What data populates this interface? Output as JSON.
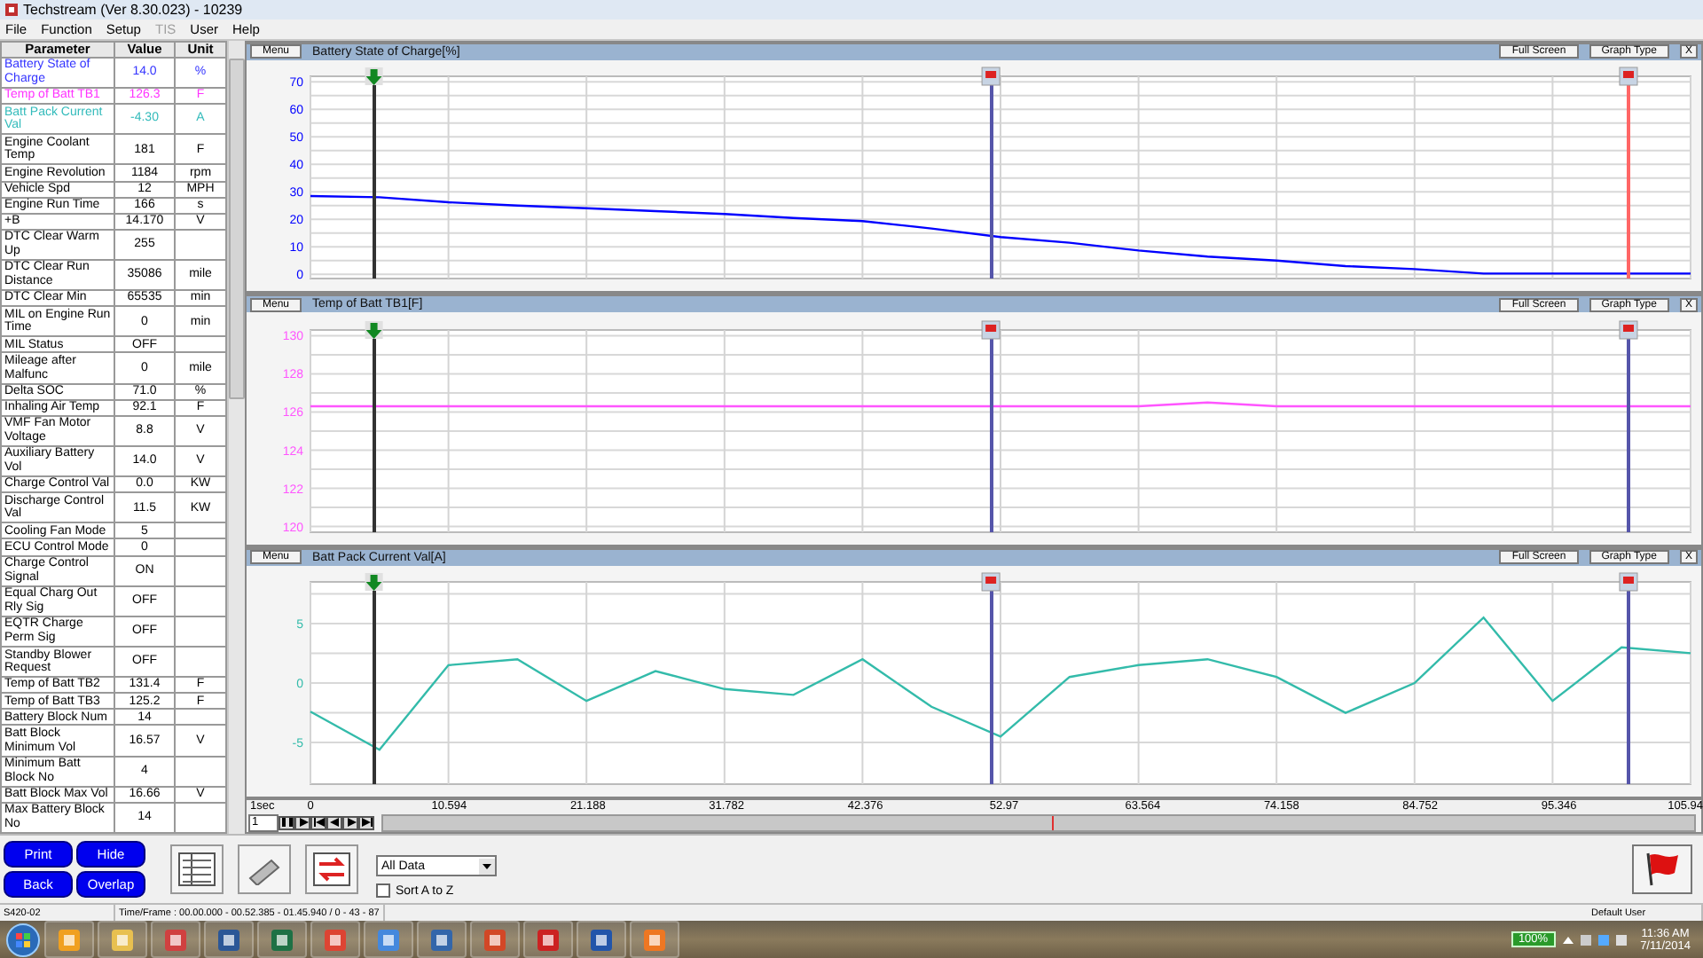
{
  "window": {
    "title": "Techstream (Ver 8.30.023) - 10239"
  },
  "menu": [
    {
      "label": "File",
      "disabled": false
    },
    {
      "label": "Function",
      "disabled": false
    },
    {
      "label": "Setup",
      "disabled": false
    },
    {
      "label": "TIS",
      "disabled": true
    },
    {
      "label": "User",
      "disabled": false
    },
    {
      "label": "Help",
      "disabled": false
    }
  ],
  "table": {
    "columns": [
      "Parameter",
      "Value",
      "Unit"
    ],
    "rows": [
      {
        "parameter": "Battery State of Charge",
        "value": "14.0",
        "unit": "%",
        "color": "#3333ff"
      },
      {
        "parameter": "Temp of Batt TB1",
        "value": "126.3",
        "unit": "F",
        "color": "#ff33ff"
      },
      {
        "parameter": "Batt Pack Current Val",
        "value": "-4.30",
        "unit": "A",
        "color": "#33bbbb"
      },
      {
        "parameter": "Engine Coolant Temp",
        "value": "181",
        "unit": "F",
        "color": "#000000"
      },
      {
        "parameter": "Engine Revolution",
        "value": "1184",
        "unit": "rpm",
        "color": "#000000"
      },
      {
        "parameter": "Vehicle Spd",
        "value": "12",
        "unit": "MPH",
        "color": "#000000"
      },
      {
        "parameter": "Engine Run Time",
        "value": "166",
        "unit": "s",
        "color": "#000000"
      },
      {
        "parameter": "+B",
        "value": "14.170",
        "unit": "V",
        "color": "#000000"
      },
      {
        "parameter": "DTC Clear Warm Up",
        "value": "255",
        "color": "#000000"
      },
      {
        "parameter": "DTC Clear Run Distance",
        "value": "35086",
        "unit": "mile",
        "color": "#000000"
      },
      {
        "parameter": "DTC Clear Min",
        "value": "65535",
        "unit": "min",
        "color": "#000000"
      },
      {
        "parameter": "MIL on Engine Run Time",
        "value": "0",
        "unit": "min",
        "color": "#000000"
      },
      {
        "parameter": "MIL Status",
        "value": "OFF",
        "color": "#000000"
      },
      {
        "parameter": "Mileage after Malfunc",
        "value": "0",
        "unit": "mile",
        "color": "#000000"
      },
      {
        "parameter": "Delta SOC",
        "value": "71.0",
        "unit": "%",
        "color": "#000000"
      },
      {
        "parameter": "Inhaling Air Temp",
        "value": "92.1",
        "unit": "F",
        "color": "#000000"
      },
      {
        "parameter": "VMF Fan Motor Voltage",
        "value": "8.8",
        "unit": "V",
        "color": "#000000"
      },
      {
        "parameter": "Auxiliary Battery Vol",
        "value": "14.0",
        "unit": "V",
        "color": "#000000"
      },
      {
        "parameter": "Charge Control Val",
        "value": "0.0",
        "unit": "KW",
        "color": "#000000"
      },
      {
        "parameter": "Discharge Control Val",
        "value": "11.5",
        "unit": "KW",
        "color": "#000000"
      },
      {
        "parameter": "Cooling Fan Mode",
        "value": "5",
        "color": "#000000"
      },
      {
        "parameter": "ECU Control Mode",
        "value": "0",
        "color": "#000000"
      },
      {
        "parameter": "Charge Control Signal",
        "value": "ON",
        "color": "#000000"
      },
      {
        "parameter": "Equal Charg Out Rly Sig",
        "value": "OFF",
        "color": "#000000"
      },
      {
        "parameter": "EQTR Charge Perm Sig",
        "value": "OFF",
        "color": "#000000"
      },
      {
        "parameter": "Standby Blower Request",
        "value": "OFF",
        "color": "#000000"
      },
      {
        "parameter": "Temp of Batt TB2",
        "value": "131.4",
        "unit": "F",
        "color": "#000000"
      },
      {
        "parameter": "Temp of Batt TB3",
        "value": "125.2",
        "unit": "F",
        "color": "#000000"
      },
      {
        "parameter": "Battery Block Num",
        "value": "14",
        "color": "#000000"
      },
      {
        "parameter": "Batt Block Minimum Vol",
        "value": "16.57",
        "unit": "V",
        "color": "#000000"
      },
      {
        "parameter": "Minimum Batt Block No",
        "value": "4",
        "color": "#000000"
      },
      {
        "parameter": "Batt Block Max Vol",
        "value": "16.66",
        "unit": "V",
        "color": "#000000"
      },
      {
        "parameter": "Max Battery Block No",
        "value": "14",
        "color": "#000000"
      }
    ]
  },
  "buttons": [
    "Print",
    "Hide",
    "Back",
    "Overlap"
  ],
  "graphs": [
    {
      "menu": "Menu",
      "title": "Battery State of Charge[%]",
      "full_screen": "Full Screen",
      "graph_type": "Graph Type",
      "close": "X",
      "cursors": [
        {
          "kind": "start",
          "level": 0.046,
          "color": "#333333"
        },
        {
          "kind": "flag",
          "level": 0.493,
          "color": "#5555aa"
        },
        {
          "kind": "flag",
          "level": 0.955,
          "color": "#ff6666"
        }
      ],
      "chart_data": {
        "type": "line",
        "categories": [
          null,
          null,
          null,
          null,
          null,
          null,
          null,
          null,
          null,
          null,
          null,
          null,
          null,
          null,
          null,
          null,
          null,
          null,
          null,
          null,
          null
        ],
        "series": [
          {
            "color": "#0000ff",
            "values": [
              28.5,
              28,
              26.2,
              25,
              24,
              23,
              22,
              20.5,
              19.4,
              16.7,
              13.6,
              11.5,
              8.7,
              6.5,
              5,
              3,
              1.9,
              0.3,
              0.3,
              0.3,
              0.3
            ]
          }
        ],
        "grid": true,
        "ylim": [
          -1.5,
          72
        ],
        "yticks": [
          0,
          10,
          20,
          30,
          40,
          50,
          60,
          70
        ]
      }
    },
    {
      "menu": "Menu",
      "title": "Temp of Batt TB1[F]",
      "full_screen": "Full Screen",
      "graph_type": "Graph Type",
      "close": "X",
      "cursors": [
        {
          "kind": "start",
          "level": 0.046,
          "color": "#333333"
        },
        {
          "kind": "flag",
          "level": 0.493,
          "color": "#5555aa"
        },
        {
          "kind": "flag",
          "level": 0.955,
          "color": "#5555aa"
        }
      ],
      "chart_data": {
        "type": "line",
        "categories": [
          null,
          null,
          null,
          null,
          null,
          null,
          null,
          null,
          null,
          null,
          null,
          null,
          null,
          null,
          null,
          null,
          null,
          null,
          null,
          null,
          null
        ],
        "series": [
          {
            "color": "#ff55ff",
            "values": [
              126.3,
              126.3,
              126.3,
              126.3,
              126.3,
              126.3,
              126.3,
              126.3,
              126.3,
              126.3,
              126.3,
              126.3,
              126.3,
              126.5,
              126.3,
              126.3,
              126.3,
              126.3,
              126.3,
              126.3,
              126.3
            ]
          }
        ],
        "grid": true,
        "ylim": [
          119.7,
          130.3
        ],
        "yticks": [
          120,
          122,
          124,
          126,
          128,
          130
        ]
      }
    },
    {
      "menu": "Menu",
      "title": "Batt Pack Current Val[A]",
      "full_screen": "Full Screen",
      "graph_type": "Graph Type",
      "close": "X",
      "cursors": [
        {
          "kind": "start",
          "level": 0.046,
          "color": "#333333"
        },
        {
          "kind": "flag",
          "level": 0.493,
          "color": "#5555aa"
        },
        {
          "kind": "flag",
          "level": 0.955,
          "color": "#5555aa"
        }
      ],
      "chart_data": {
        "type": "line",
        "categories": [
          null,
          null,
          null,
          null,
          null,
          null,
          null,
          null,
          null,
          null,
          null,
          null,
          null,
          null,
          null,
          null,
          null,
          null,
          null,
          null,
          null
        ],
        "series": [
          {
            "color": "#33bbaa",
            "values": [
              -2.4,
              -5.6,
              1.5,
              2.0,
              -1.5,
              1.0,
              -0.5,
              -1.0,
              2.0,
              -2.0,
              -4.5,
              0.5,
              1.5,
              2.0,
              0.5,
              -2.5,
              0.0,
              5.5,
              -1.5,
              3.0,
              2.5
            ]
          }
        ],
        "grid": true,
        "ylim": [
          -8.5,
          8.5
        ],
        "yticks": [
          -5,
          0,
          5
        ]
      }
    }
  ],
  "time_axis": {
    "unit": "1sec",
    "step": "1",
    "ticks": [
      "0",
      "10.594",
      "21.188",
      "31.782",
      "42.376",
      "52.97",
      "63.564",
      "74.158",
      "84.752",
      "95.346",
      "105.94"
    ],
    "level": 0.51
  },
  "toolbar": {
    "filter": "All Data",
    "sort": {
      "label": "Sort A to Z",
      "checked": false
    }
  },
  "status_bar": {
    "code": "S420-02",
    "time_frame": "Time/Frame : 00.00.000 - 00.52.385 - 01.45.940 / 0 - 43 - 87",
    "user": "Default User"
  },
  "taskbar": {
    "battery": "100%",
    "time": "11:36 AM",
    "date": "7/11/2014"
  }
}
